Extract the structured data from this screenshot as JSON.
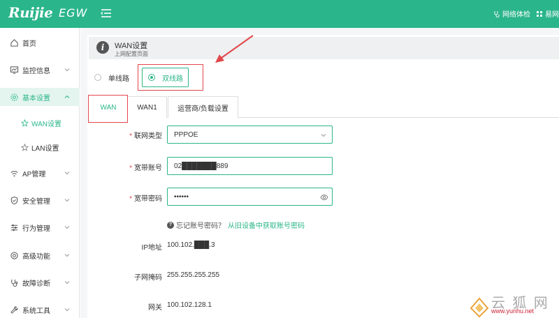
{
  "header": {
    "brand": "Ruijie",
    "model": "EGW",
    "network_check": "网络体检",
    "easy": "易网"
  },
  "sidebar": {
    "items": [
      {
        "label": "首页",
        "icon": "home-icon"
      },
      {
        "label": "监控信息",
        "icon": "monitor-icon"
      },
      {
        "label": "基本设置",
        "icon": "gear-icon"
      },
      {
        "label": "WAN设置",
        "icon": "star-icon"
      },
      {
        "label": "LAN设置",
        "icon": "star-icon"
      },
      {
        "label": "AP管理",
        "icon": "wifi-icon"
      },
      {
        "label": "安全管理",
        "icon": "shield-icon"
      },
      {
        "label": "行为管理",
        "icon": "sliders-icon"
      },
      {
        "label": "高级功能",
        "icon": "target-icon"
      },
      {
        "label": "故障诊断",
        "icon": "stethoscope-icon"
      },
      {
        "label": "系统工具",
        "icon": "wrench-icon"
      }
    ]
  },
  "page": {
    "title": "WAN设置",
    "subtitle": "上网配置页面"
  },
  "line_mode": {
    "single": "单线路",
    "dual": "双线路",
    "selected": "双线路"
  },
  "tabs": [
    "WAN",
    "WAN1",
    "运营商/负载设置"
  ],
  "form": {
    "conn_type_label": "联网类型",
    "conn_type_value": "PPPOE",
    "account_label": "宽带账号",
    "account_value": "02███████889",
    "password_label": "宽带密码",
    "password_value": "••••••",
    "hint_text": "忘记账号密码？",
    "hint_link": "从旧设备中获取账号密码",
    "ip_label": "IP地址",
    "ip_value": "100.102.███.3",
    "mask_label": "子网掩码",
    "mask_value": "255.255.255.255",
    "gateway_label": "网关",
    "gateway_value": "100.102.128.1"
  },
  "watermark": {
    "text": "云 狐 网",
    "url": "www.yunhu.net"
  },
  "colors": {
    "accent": "#2bb58a",
    "highlight_box": "#e2474a"
  }
}
